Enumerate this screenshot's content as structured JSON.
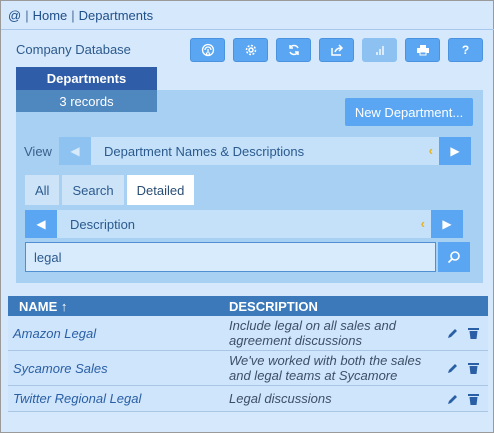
{
  "breadcrumb": {
    "root_icon": "@",
    "home": "Home",
    "current": "Departments"
  },
  "company_label": "Company Database",
  "toolbar": {
    "buttons": [
      {
        "icon": "fingerprint-icon"
      },
      {
        "icon": "gear-icon"
      },
      {
        "icon": "refresh-icon"
      },
      {
        "icon": "share-icon"
      },
      {
        "icon": "bar-chart-icon",
        "disabled": true
      },
      {
        "icon": "printer-icon"
      },
      {
        "icon": "help-icon",
        "label": "?"
      }
    ]
  },
  "departments_tab": {
    "label": "Departments",
    "records": "3 records"
  },
  "new_department_label": "New Department...",
  "view": {
    "label": "View",
    "selected": "Department Names & Descriptions"
  },
  "subtabs": [
    {
      "label": "All",
      "active": false
    },
    {
      "label": "Search",
      "active": false
    },
    {
      "label": "Detailed",
      "active": true
    }
  ],
  "field_selector": {
    "selected": "Description"
  },
  "search": {
    "value": "legal"
  },
  "table": {
    "headers": {
      "name": "NAME ↑",
      "description": "DESCRIPTION"
    },
    "rows": [
      {
        "name": "Amazon Legal",
        "description": "Include legal on all sales and agreement discussions"
      },
      {
        "name": "Sycamore Sales",
        "description": "We've worked with both the sales and legal teams at Sycamore"
      },
      {
        "name": "Twitter Regional Legal",
        "description": "Legal discussions"
      }
    ]
  },
  "colors": {
    "accent": "#5aa6f2",
    "tab_dark": "#2f5da7",
    "panel": "#a8d0f2",
    "background": "#d6e8fb"
  }
}
